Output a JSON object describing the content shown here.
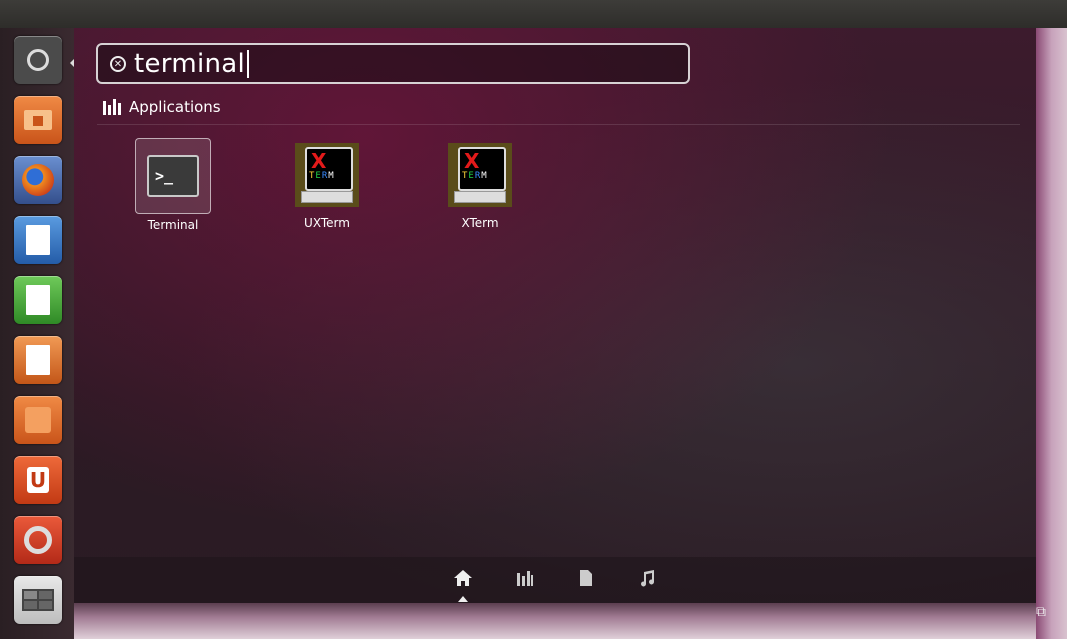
{
  "search": {
    "query": "terminal"
  },
  "category": {
    "label": "Applications"
  },
  "results": [
    {
      "label": "Terminal",
      "icon": "terminal-icon"
    },
    {
      "label": "UXTerm",
      "icon": "xterm-icon"
    },
    {
      "label": "XTerm",
      "icon": "xterm-icon"
    }
  ],
  "launcher": [
    {
      "name": "ubuntu-dash-icon",
      "color": "#4a4a4a"
    },
    {
      "name": "home-folder-icon",
      "color": "#d9651d"
    },
    {
      "name": "firefox-icon",
      "color": "#c04a2c"
    },
    {
      "name": "libreoffice-writer-icon",
      "color": "#2a6dbf"
    },
    {
      "name": "libreoffice-calc-icon",
      "color": "#3a9a2e"
    },
    {
      "name": "libreoffice-impress-icon",
      "color": "#d2611e"
    },
    {
      "name": "software-center-icon",
      "color": "#e06a20"
    },
    {
      "name": "ubuntu-one-icon",
      "color": "#e2521f"
    },
    {
      "name": "system-settings-icon",
      "color": "#cf3c2a"
    },
    {
      "name": "workspace-switcher-icon",
      "color": "#6a6a6a"
    }
  ],
  "lenses": [
    "home-lens-icon",
    "applications-lens-icon",
    "files-lens-icon",
    "music-lens-icon"
  ],
  "xterm_text": {
    "x": "X",
    "term": "TERM"
  }
}
